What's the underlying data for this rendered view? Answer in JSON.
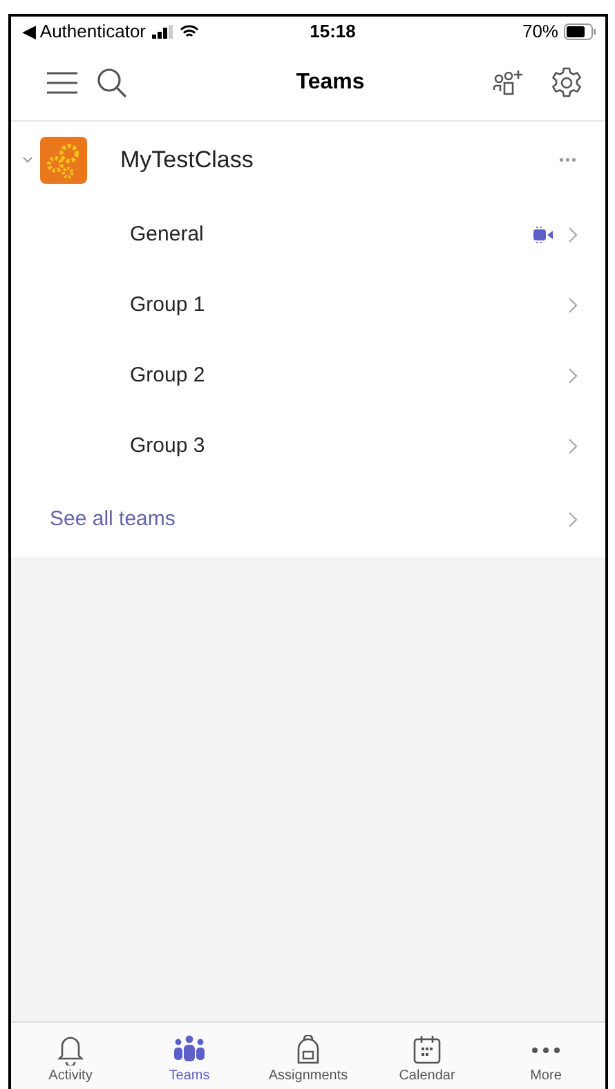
{
  "status_bar": {
    "back_app": "◀ Authenticator",
    "time": "15:18",
    "battery": "70%"
  },
  "nav": {
    "title": "Teams"
  },
  "team": {
    "name": "MyTestClass",
    "expanded": true,
    "more": "•••",
    "channels": [
      {
        "name": "General",
        "meeting": true
      },
      {
        "name": "Group 1",
        "meeting": false
      },
      {
        "name": "Group 2",
        "meeting": false
      },
      {
        "name": "Group 3",
        "meeting": false
      }
    ]
  },
  "see_all": "See all teams",
  "tabs": [
    {
      "label": "Activity",
      "kind": "bell",
      "selected": false
    },
    {
      "label": "Teams",
      "kind": "teams",
      "selected": true
    },
    {
      "label": "Assignments",
      "kind": "bag",
      "selected": false
    },
    {
      "label": "Calendar",
      "kind": "calendar",
      "selected": false
    },
    {
      "label": "More",
      "kind": "more",
      "selected": false
    }
  ]
}
